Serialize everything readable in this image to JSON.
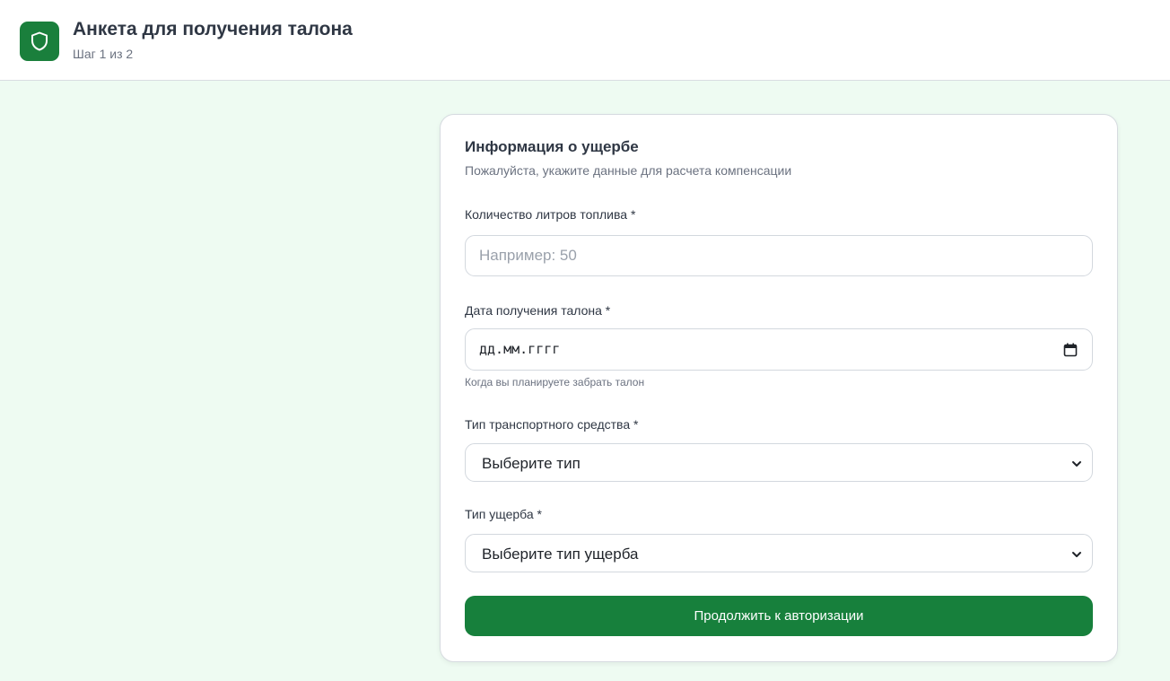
{
  "header": {
    "title": "Анкета для получения талона",
    "step": "Шаг 1 из 2",
    "logo_icon": "shield-icon",
    "brand_color": "#1a7f3c"
  },
  "card": {
    "title": "Информация о ущербе",
    "subtitle": "Пожалуйста, укажите данные для расчета компенсации"
  },
  "fields": {
    "fuel": {
      "label": "Количество литров топлива *",
      "value": "",
      "placeholder": "Например: 50"
    },
    "date": {
      "label": "Дата получения талона *",
      "value": "дд.мм.гггг",
      "hint": "Когда вы планируете забрать талон",
      "icon": "calendar-icon"
    },
    "vehicle": {
      "label": "Тип транспортного средства *",
      "selected": "Выберите тип"
    },
    "damage": {
      "label": "Тип ущерба *",
      "selected": "Выберите тип ущерба"
    }
  },
  "actions": {
    "continue_label": "Продолжить к авторизации",
    "button_color": "#17803c"
  }
}
